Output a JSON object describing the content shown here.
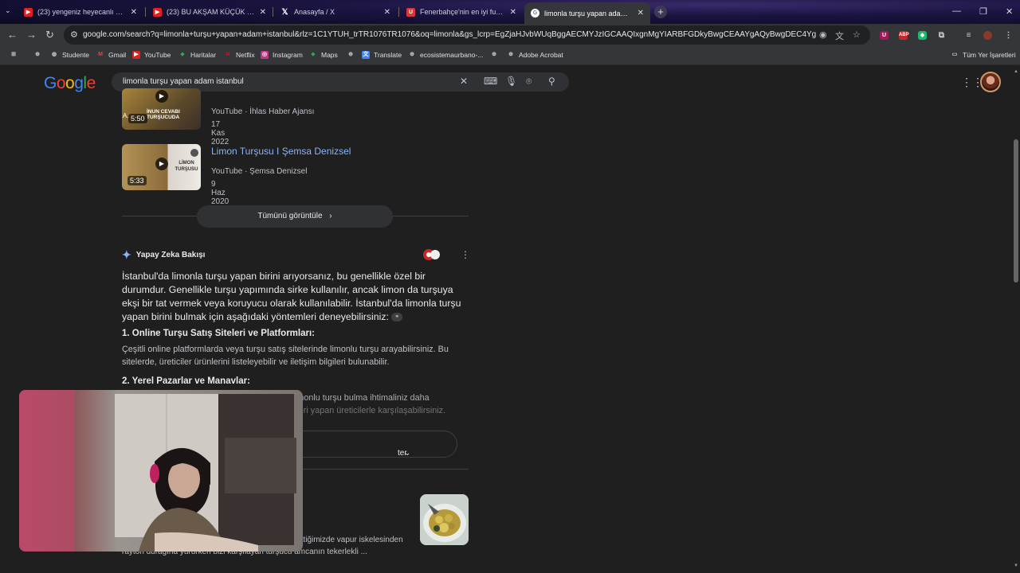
{
  "browser": {
    "tabs": [
      {
        "title": "(23) yengeniz heyecanlı pandik",
        "favicon": "youtube-icon",
        "active": false
      },
      {
        "title": "(23) BU AKŞAM KÜÇÜK BİR SİK",
        "favicon": "youtube-icon",
        "active": false
      },
      {
        "title": "Anasayfa / X",
        "favicon": "x-icon",
        "active": false
      },
      {
        "title": "Fenerbahçe'nin en iyi futbolcu",
        "favicon": "u-icon",
        "active": false
      },
      {
        "title": "limonla turşu yapan adam ista",
        "favicon": "google-icon",
        "active": true
      }
    ],
    "url": "google.com/search?q=limonla+turşu+yapan+adam+istanbul&rlz=1C1YTUH_trTR1076TR1076&oq=limonla&gs_lcrp=EgZjaHJvbWUqBggAECMYJzIGCAAQIxgnMgYIARBFGDkyBwgCEAAYgAQyBwgDEC4YgAQyBwgEEAAYgA...",
    "bookmarks": [
      {
        "label": "Studente",
        "icon": "globe-icon"
      },
      {
        "label": "Gmail",
        "icon": "gmail-icon"
      },
      {
        "label": "YouTube",
        "icon": "youtube-icon"
      },
      {
        "label": "Haritalar",
        "icon": "maps-icon"
      },
      {
        "label": "Netflix",
        "icon": "netflix-icon"
      },
      {
        "label": "Instagram",
        "icon": "instagram-icon"
      },
      {
        "label": "Maps",
        "icon": "maps-icon"
      },
      {
        "label": "",
        "icon": "globe-icon"
      },
      {
        "label": "Translate",
        "icon": "translate-icon"
      },
      {
        "label": "ecosistemaurbano-...",
        "icon": "globe-icon"
      },
      {
        "label": "",
        "icon": "globe-icon"
      },
      {
        "label": "Adobe Acrobat",
        "icon": "globe-icon"
      }
    ],
    "all_bookmarks": "Tüm Yer İşaretleri"
  },
  "google": {
    "logo": "Google",
    "query": "limonla turşu yapan adam istanbul"
  },
  "videos": [
    {
      "title": "",
      "source": "YouTube · İhlas Haber Ajansı",
      "date": "17 Kas 2022",
      "duration": "5:50",
      "thumb_text": "İNUN CEVABI TURŞUCUDA",
      "thumb_prefix": "A."
    },
    {
      "title": "Limon Turşusu I Şemsa Denizsel",
      "source": "YouTube · Şemsa Denizsel",
      "date": "9 Haz 2020",
      "duration": "5:33",
      "thumb_text": "LİMON TURŞUSU"
    }
  ],
  "view_all": "Tümünü görüntüle",
  "ai_overview": {
    "heading": "Yapay Zeka Bakışı",
    "intro": "İstanbul'da limonla turşu yapan birini arıyorsanız, bu genellikle özel bir durumdur. Genellikle turşu yapımında sirke kullanılır, ancak limon da turşuya ekşi bir tat vermek veya koruyucu olarak kullanılabilir. İstanbul'da limonla turşu yapan birini bulmak için aşağıdaki yöntemleri deneyebilirsiniz:",
    "section1_title": "1. Online Turşu Satış Siteleri ve Platformları:",
    "section1_text": "Çeşitli online platformlarda veya turşu satış sitelerinde limonlu turşu arayabilirsiniz. Bu sitelerde, üreticiler ürünlerini listeleyebilir ve iletişim bilgileri bulunabilir.",
    "section2_title": "2. Yerel Pazarlar ve Manavlar:",
    "section2_line1": "imonlu turşu bulma ihtimaliniz daha",
    "section2_line2": "lleri yapan üreticilerle karşılaşabilirsiniz.",
    "show_more": "ter"
  },
  "result": {
    "snippet_line1": "gittiğimizde vapur iskelesinden",
    "snippet_line2": "rayton durağına yürürken bizi karşılayan turşucu amcanın tekerlekli ..."
  },
  "colors": {
    "link": "#8ab4f8",
    "background": "#1f1f1f",
    "toolbar": "#35363a"
  }
}
